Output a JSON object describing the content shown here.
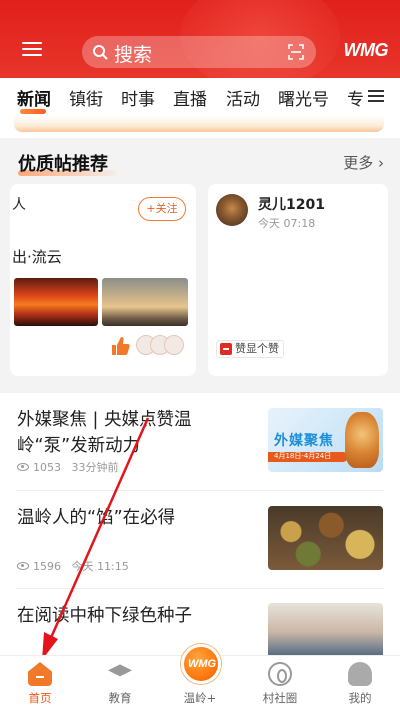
{
  "header": {
    "search_placeholder": "搜索",
    "logo_text": "WMG",
    "colors": {
      "primary": "#e0201c",
      "accent": "#ea5a1c"
    }
  },
  "tabs": [
    {
      "label": "新闻",
      "active": true
    },
    {
      "label": "镇街"
    },
    {
      "label": "时事"
    },
    {
      "label": "直播"
    },
    {
      "label": "活动"
    },
    {
      "label": "曙光号"
    },
    {
      "label": "专"
    }
  ],
  "featured": {
    "title": "优质帖推荐",
    "more": "更多",
    "card1": {
      "name_partial": "人",
      "follow": "+关注",
      "text": "出·流云"
    },
    "card2": {
      "name": "灵儿1201",
      "time": "今天 07:18",
      "tag": "赞显个赞"
    }
  },
  "news": [
    {
      "title": "外媒聚焦 | 央媒点赞温岭“泵”发新动力",
      "views": "1053",
      "time": "33分钟前",
      "thumb_title": "外媒聚焦",
      "thumb_date": "4月18日-4月24日"
    },
    {
      "title": "温岭人的“馅”在必得",
      "views": "1596",
      "time": "今天 11:15"
    },
    {
      "title": "在阅读中种下绿色种子"
    }
  ],
  "bottom_nav": [
    {
      "label": "首页",
      "icon": "home-icon",
      "active": true
    },
    {
      "label": "教育",
      "icon": "graduation-cap-icon"
    },
    {
      "label": "温岭+",
      "icon": "wmg-logo-icon"
    },
    {
      "label": "村社圈",
      "icon": "community-icon"
    },
    {
      "label": "我的",
      "icon": "profile-icon"
    }
  ]
}
